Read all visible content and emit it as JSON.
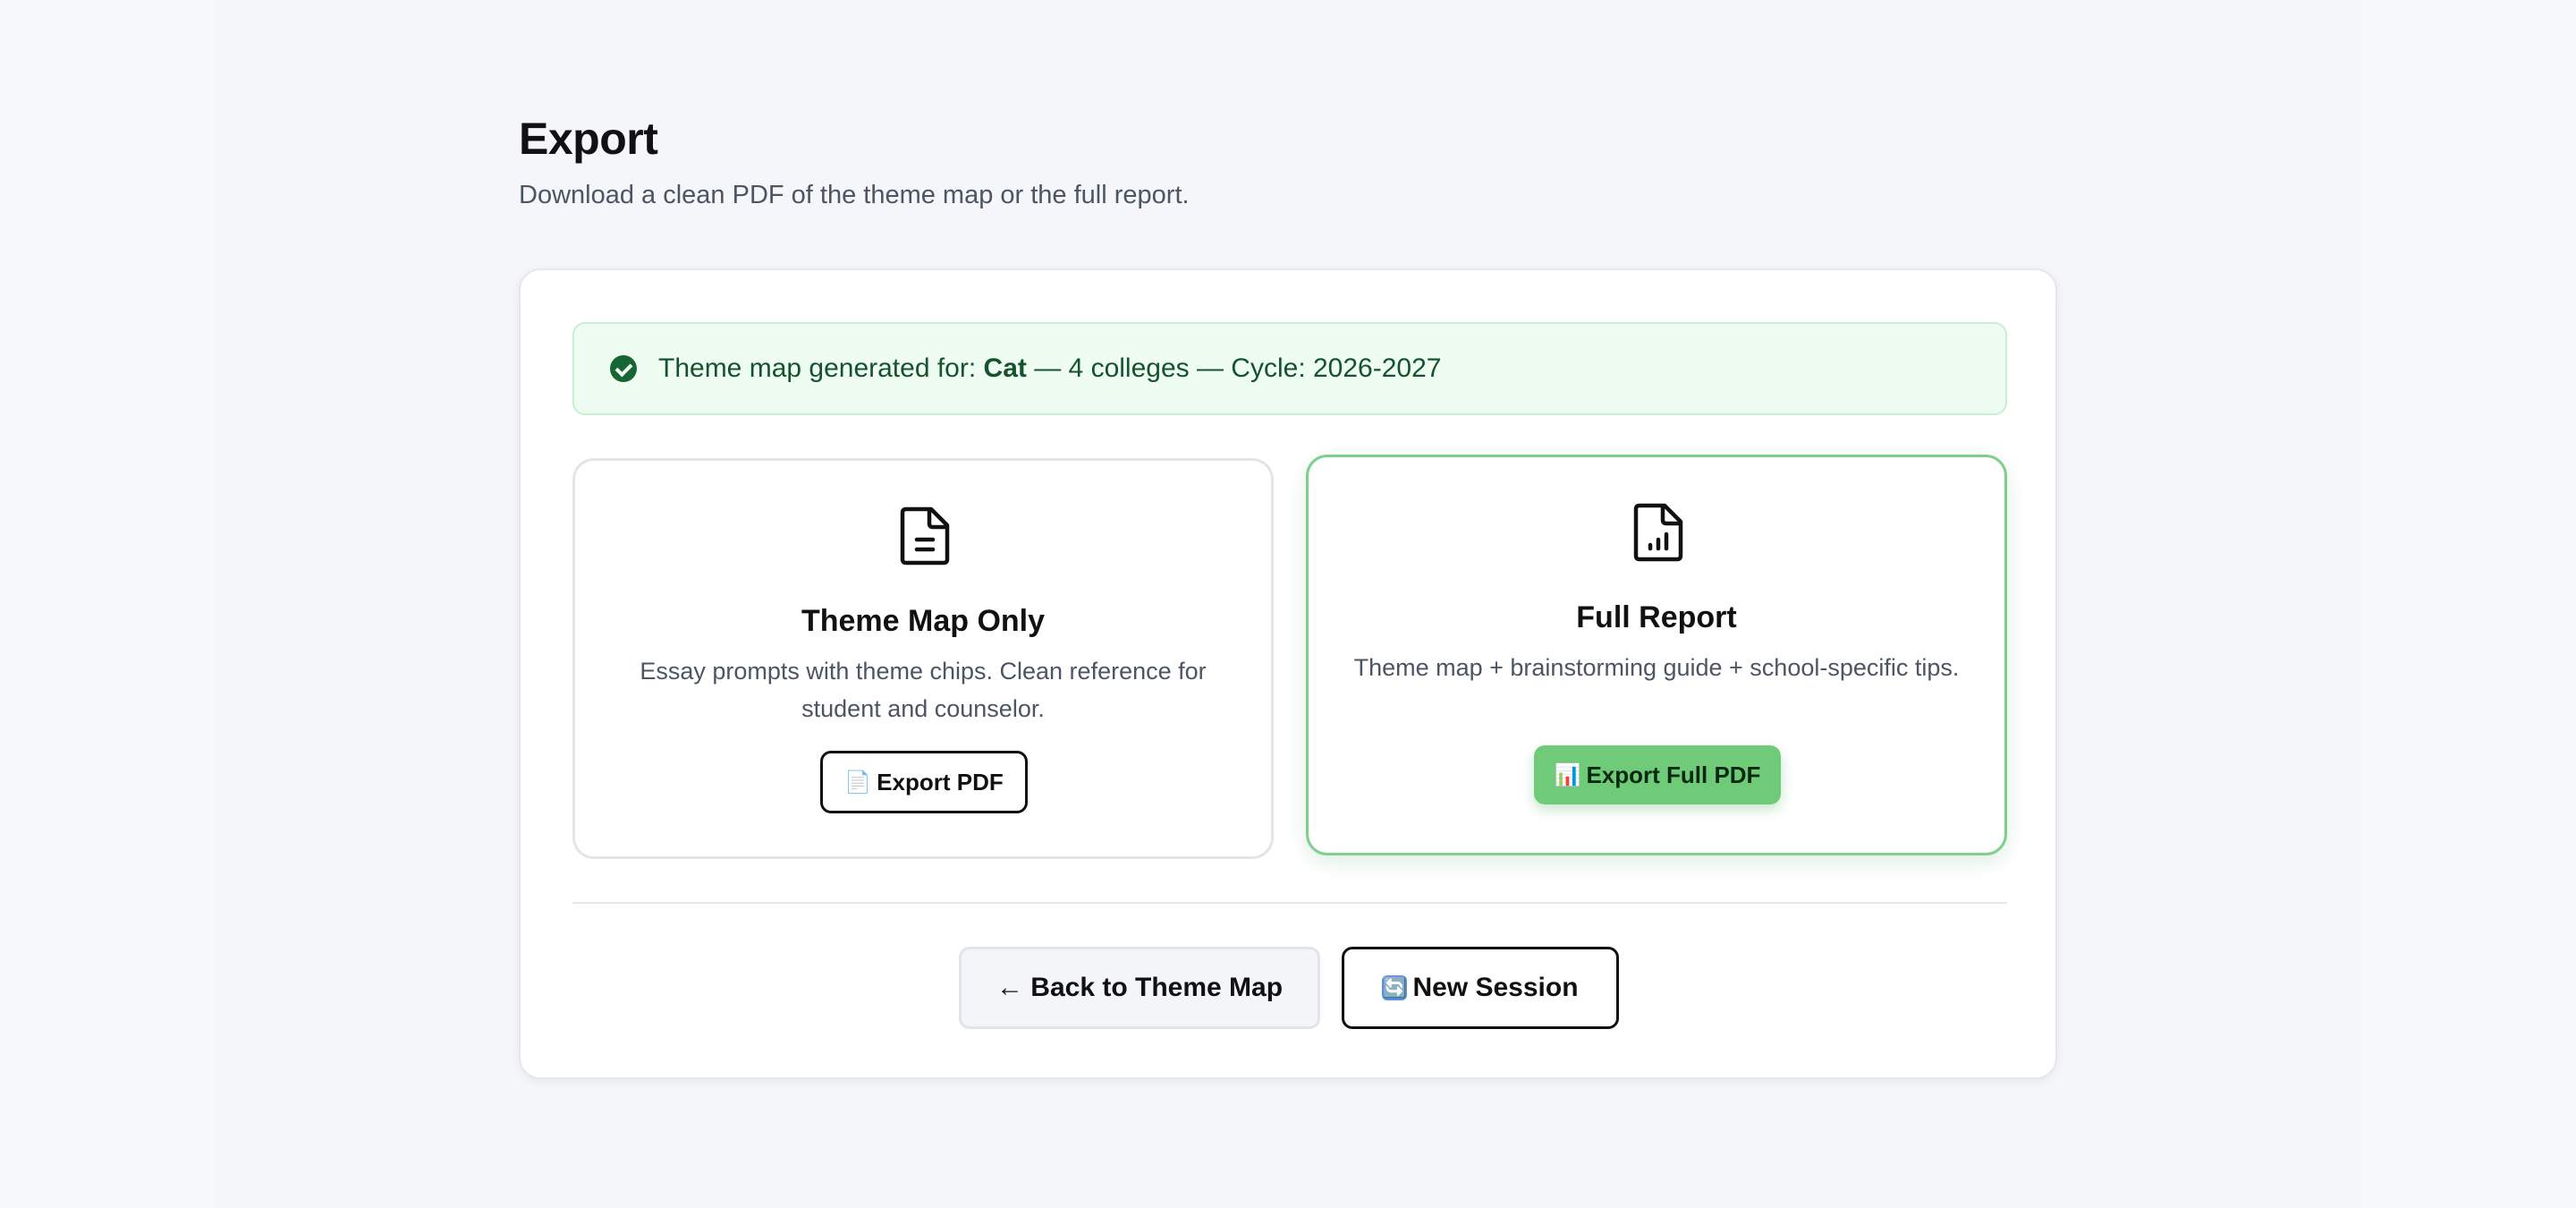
{
  "page": {
    "title": "Export",
    "subtitle": "Download a clean PDF of the theme map or the full report."
  },
  "banner": {
    "prefix": "Theme map generated for: ",
    "student": "Cat",
    "suffix": " — 4 colleges — Cycle: 2026-2027",
    "icon": "check-circle-icon"
  },
  "options": {
    "theme_map": {
      "title": "Theme Map Only",
      "description": "Essay prompts with theme chips. Clean reference for student and counselor.",
      "button_icon": "📄",
      "button_label": "Export PDF",
      "icon": "document-text-icon"
    },
    "full_report": {
      "title": "Full Report",
      "description": "Theme map + brainstorming guide + school-specific tips.",
      "button_icon": "📊",
      "button_label": "Export Full PDF",
      "icon": "document-chart-icon"
    }
  },
  "actions": {
    "back_label": "← Back to Theme Map",
    "new_session_icon": "🔄",
    "new_session_label": "New Session"
  },
  "colors": {
    "accent_green": "#6fcb78",
    "banner_bg": "#effcf2",
    "banner_text": "#14532d"
  }
}
